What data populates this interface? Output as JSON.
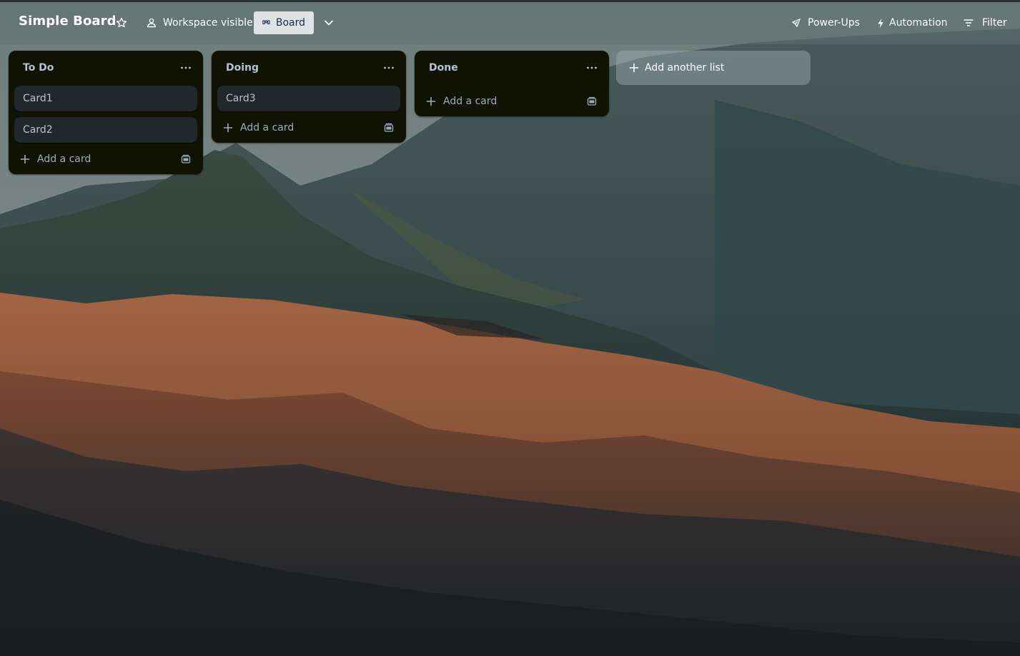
{
  "board": {
    "title": "Simple Board"
  },
  "header": {
    "star_icon": "star-icon",
    "visibility_label": "Workspace visible",
    "view_label": "Board",
    "powerups_label": "Power-Ups",
    "automation_label": "Automation",
    "filter_label": "Filter"
  },
  "lists": [
    {
      "title": "To Do",
      "cards": [
        "Card1",
        "Card2"
      ],
      "add_card_label": "Add a card"
    },
    {
      "title": "Doing",
      "cards": [
        "Card3"
      ],
      "add_card_label": "Add a card"
    },
    {
      "title": "Done",
      "cards": [],
      "add_card_label": "Add a card"
    }
  ],
  "add_list_label": "Add another list",
  "colors": {
    "list_bg": "#101204",
    "card_bg": "#22272b",
    "list_title": "#b6c2cf",
    "view_button_bg": "#dfe3e6"
  }
}
